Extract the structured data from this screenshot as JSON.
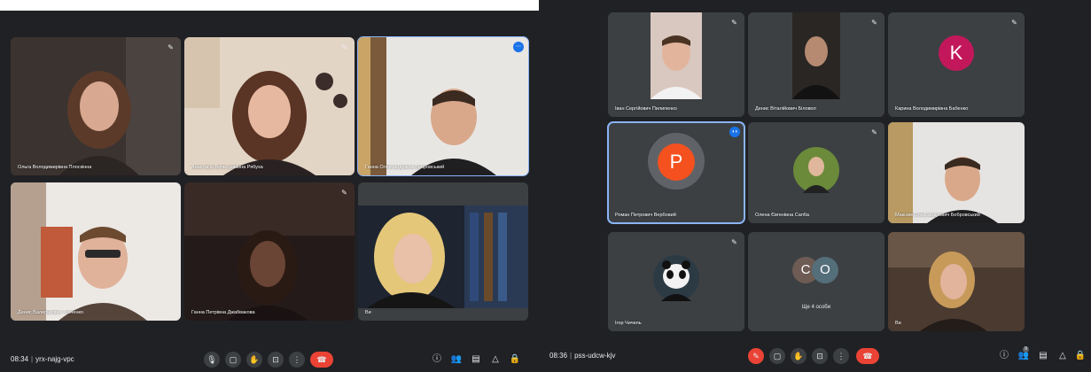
{
  "left": {
    "participants": [
      {
        "name": "Ольга Володимирівна Плоскінна",
        "mic": "mic-off"
      },
      {
        "name": "Анастасія Вячеславівна Рябуха",
        "mic": "mic-off"
      },
      {
        "name": "Ганна Олександрівна Бобровський",
        "mic": "more"
      },
      {
        "name": "Денис Валерійович Ткаченко",
        "mic": "mic-off"
      },
      {
        "name": "Ганна Петрівна Джабвакова",
        "mic": "mic-off"
      },
      {
        "name": "Ви",
        "mic": "none"
      }
    ],
    "meeting": {
      "time": "08:34",
      "code": "yrx-najg-vpc"
    }
  },
  "right": {
    "participants": [
      {
        "name": "Іван Сергійович Пилипенко",
        "mic": "mic-off"
      },
      {
        "name": "Денис Віталійович Біловол",
        "mic": "mic-off"
      },
      {
        "name": "Карина Володимирівна Бабенко",
        "mic": "mic-off",
        "avatar_letter": "K",
        "avatar_color": "#c2185b"
      },
      {
        "name": "Роман Петрович Вербовий",
        "mic": "speaking",
        "avatar_letter": "P",
        "avatar_color": "#f4511e"
      },
      {
        "name": "Олена Євгенівна Сапба",
        "mic": "mic-off"
      },
      {
        "name": "Максим Олександрович Бобровський",
        "mic": "none"
      },
      {
        "name": "Ігор Чичель",
        "mic": "mic-off"
      },
      {
        "name": "",
        "mic": "none"
      },
      {
        "name": "Ви",
        "mic": "none"
      }
    ],
    "more": {
      "letters": [
        "C",
        "O"
      ],
      "label": "Ще 4 особи"
    },
    "meeting": {
      "time": "08:36",
      "code": "pss-udcw-kjv"
    }
  },
  "colors": {
    "bg": "#202124",
    "tile": "#3c4043",
    "hangup": "#ea4335",
    "accent": "#1a73e8"
  },
  "icons": [
    "mic-off-icon",
    "mic-icon",
    "camera-icon",
    "raise-hand-icon",
    "present-icon",
    "more-icon",
    "hang-up-icon",
    "info-icon",
    "people-icon",
    "chat-icon",
    "activities-icon",
    "host-controls-icon"
  ],
  "badges": {
    "people_count": "9"
  }
}
